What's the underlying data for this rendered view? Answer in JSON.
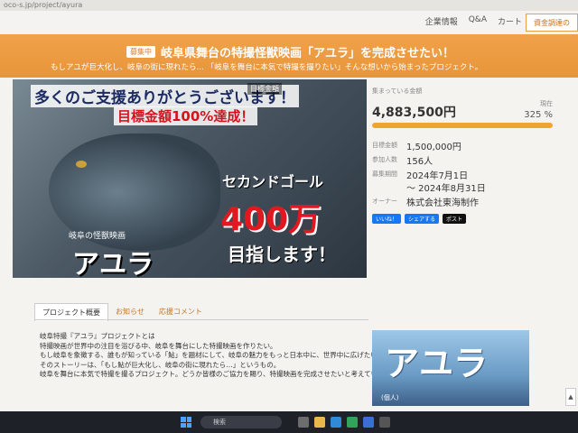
{
  "browser": {
    "url": "oco-s.jp/project/ayura"
  },
  "nav": {
    "links": [
      "企業情報",
      "Q&A",
      "カート"
    ],
    "fund_button": "資金調達の"
  },
  "banner": {
    "badge": "募集中",
    "title": "岐阜県舞台の特撮怪獣映画「アユラ」を完成させたい！",
    "subtitle": "もしアユが巨大化し、岐阜の街に現れたら… 「岐阜を舞台に本気で特撮を撮りたい」そんな想いから始まったプロジェクト。"
  },
  "hero": {
    "headline": "多くのご支援ありがとうございます！",
    "goal_label": "目標金額",
    "achieved": "目標金額100%達成！",
    "second_goal": "セカンドゴール",
    "amount": "400万",
    "aim": "目指します！",
    "film_subtitle": "岐阜の怪獣映画",
    "film_title": "アユラ"
  },
  "stats": {
    "collected_label": "集まっている金額",
    "raised": "4,883,500円",
    "now_label": "現在",
    "percent": "325 %",
    "progress": 1.0,
    "rows": [
      {
        "key": "目標金額",
        "value": "1,500,000円"
      },
      {
        "key": "参加人数",
        "value": "156人"
      },
      {
        "key": "募集期間",
        "value": "2024年7月1日"
      },
      {
        "key": "",
        "value": "〜 2024年8月31日"
      },
      {
        "key": "オーナー",
        "value": "株式会社東海制作"
      }
    ],
    "share": [
      "いいね！",
      "シェアする",
      "ポスト"
    ]
  },
  "tabs": [
    "プロジェクト概要",
    "お知らせ",
    "応援コメント"
  ],
  "body": [
    "岐阜特撮『アユラ』プロジェクトとは",
    "特撮映画が世界中の注目を浴びる中、岐阜を舞台にした特撮映画を作りたい。",
    "もし岐阜を象徴する、誰もが知っている「鮎」を題材にして、岐阜の魅力をもっと日本中に、世界中に広げたい。",
    "そのストーリーは、「もし鮎が巨大化し、岐阜の街に現れたら…」というもの。",
    "岐阜を舞台に本気で特撮を撮るプロジェクト。どうか皆様のご協力を賜り、特撮映画を完成させたいと考えています。"
  ],
  "side_image": {
    "title": "アユラ",
    "caption": "(個人)"
  },
  "taskbar": {
    "search": "検索"
  },
  "colors": {
    "accent": "#f0a24a",
    "progress": "#f0a62e",
    "red": "#e01820"
  }
}
